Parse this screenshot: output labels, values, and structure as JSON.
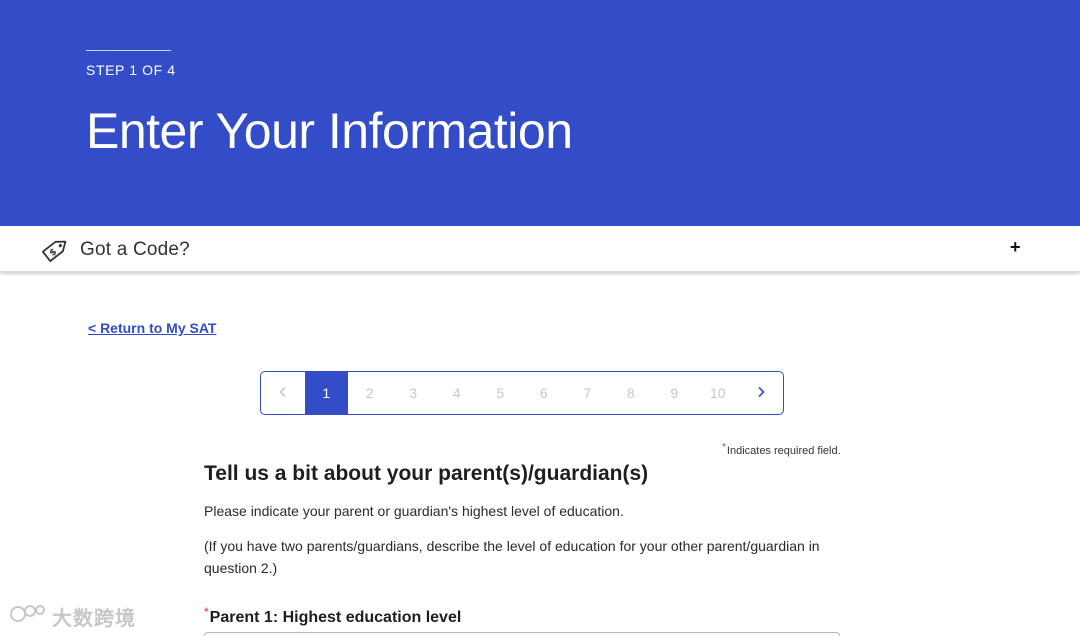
{
  "header": {
    "step": "STEP 1 OF 4",
    "title": "Enter Your Information"
  },
  "code_bar": {
    "label": "Got a Code?",
    "toggle": "+",
    "icon": "price-tag-icon"
  },
  "return_link": "< Return to My SAT",
  "pagination": {
    "prev_icon": "chevron-left-icon",
    "next_icon": "chevron-right-icon",
    "pages": [
      "1",
      "2",
      "3",
      "4",
      "5",
      "6",
      "7",
      "8",
      "9",
      "10"
    ],
    "current": "1"
  },
  "required_note": {
    "star": "*",
    "text": "Indicates required field."
  },
  "section": {
    "title": "Tell us a bit about your parent(s)/guardian(s)",
    "paragraph1": "Please indicate your parent or guardian's highest level of education.",
    "paragraph2": "(If you have two parents/guardians, describe the level of education for your other parent/guardian in question 2.)"
  },
  "question1": {
    "star": "*",
    "label": "Parent 1: Highest education level"
  },
  "watermark": {
    "text": "大数跨境"
  },
  "colors": {
    "brand_blue": "#324dc7",
    "required_red": "#d22f2f"
  }
}
